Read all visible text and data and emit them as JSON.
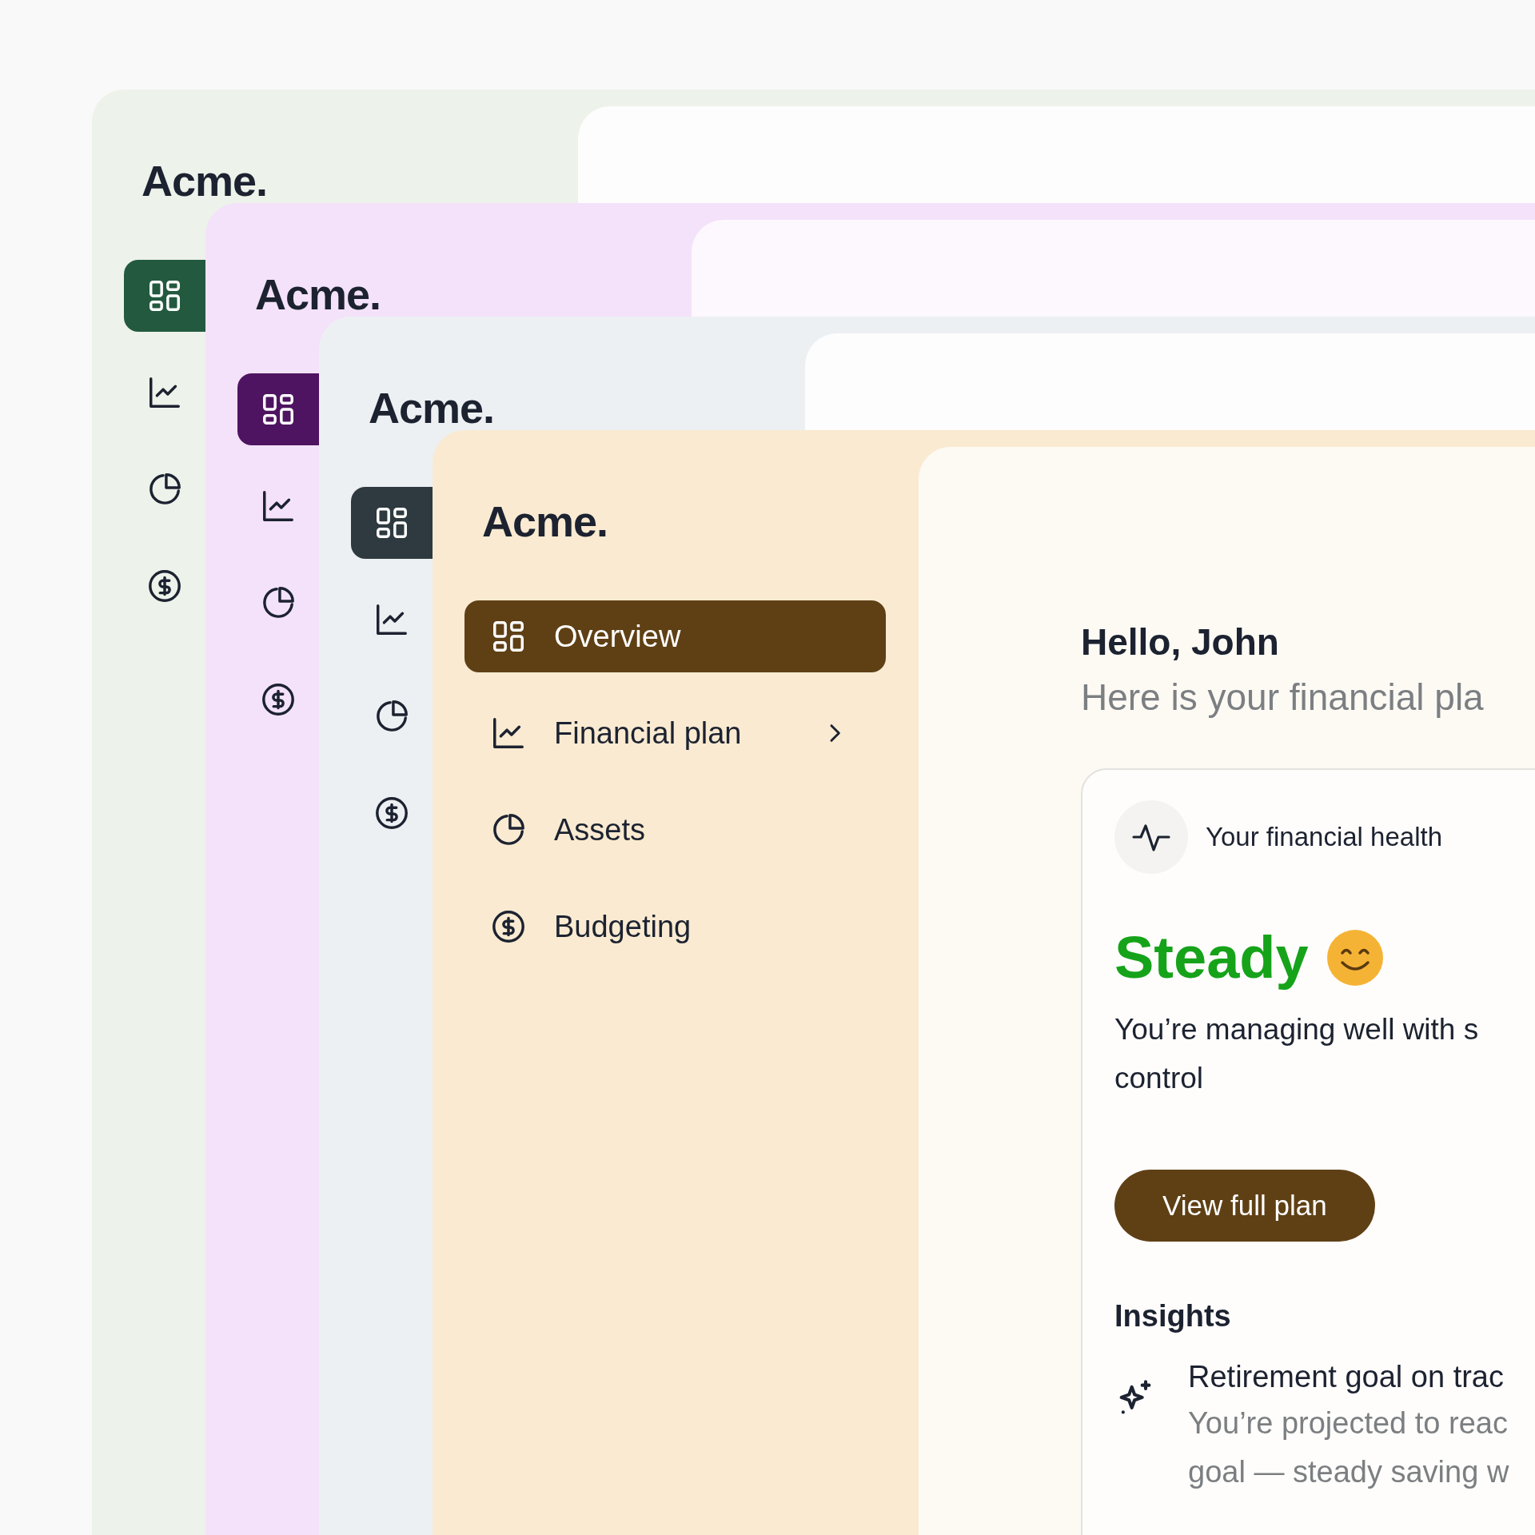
{
  "windows": [
    {
      "color": "#235a3f",
      "logo": "Acme.",
      "nav": [
        {
          "selected": true
        },
        {
          "selected": false
        },
        {
          "selected": false
        },
        {
          "selected": false
        }
      ]
    },
    {
      "color": "#4f1461",
      "logo": "Acme.",
      "nav": [
        {
          "selected": true
        },
        {
          "selected": false
        },
        {
          "selected": false
        },
        {
          "selected": false
        }
      ]
    },
    {
      "color": "#2e3a40",
      "logo": "Acme.",
      "nav": [
        {
          "selected": true
        },
        {
          "selected": false
        },
        {
          "selected": false
        },
        {
          "selected": false
        }
      ]
    },
    {
      "color": "#5f4015",
      "logo": "Acme.",
      "nav": [
        {
          "label": "Overview",
          "selected": true,
          "expandable": false
        },
        {
          "label": "Financial plan",
          "selected": false,
          "expandable": true
        },
        {
          "label": "Assets",
          "selected": false,
          "expandable": false
        },
        {
          "label": "Budgeting",
          "selected": false,
          "expandable": false
        }
      ],
      "main": {
        "greeting": "Hello, John",
        "subtitle": "Here is your financial pla",
        "card": {
          "title": "Your financial health",
          "status": "Steady",
          "description_lines": [
            "You’re managing well with s",
            "control"
          ],
          "button": "View full plan",
          "insights_heading": "Insights",
          "insights": [
            {
              "title": "Retirement goal on trac",
              "body_lines": [
                "You’re projected to reac",
                "goal — steady saving w"
              ]
            }
          ]
        }
      }
    }
  ]
}
